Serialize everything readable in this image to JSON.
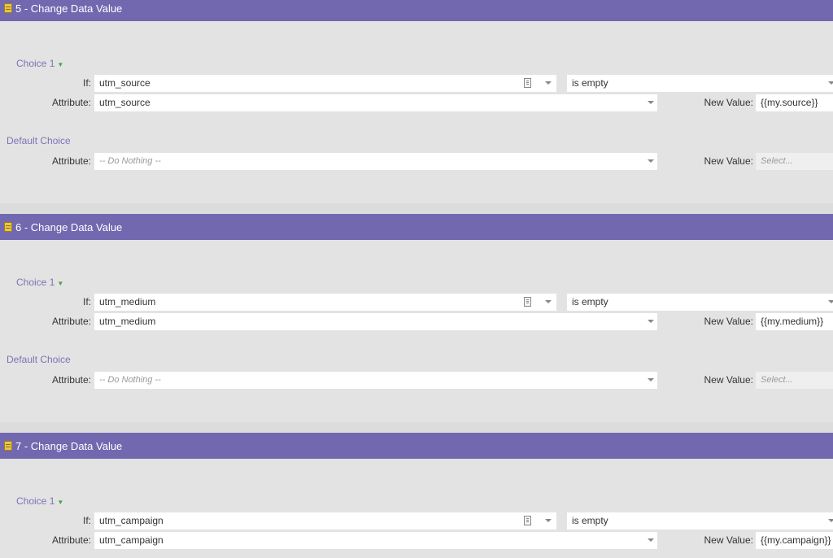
{
  "steps": [
    {
      "title": "5 - Change Data Value",
      "choice_label": "Choice 1",
      "if_label": "If:",
      "if_value": "utm_source",
      "operator": "is empty",
      "attribute_label": "Attribute:",
      "attribute_value": "utm_source",
      "new_value_label": "New Value:",
      "new_value": "{{my.source}}",
      "default_label": "Default Choice",
      "default_attribute_label": "Attribute:",
      "default_attribute_value": "-- Do Nothing --",
      "default_new_value_label": "New Value:",
      "default_new_value_placeholder": "Select..."
    },
    {
      "title": "6 - Change Data Value",
      "choice_label": "Choice 1",
      "if_label": "If:",
      "if_value": "utm_medium",
      "operator": "is empty",
      "attribute_label": "Attribute:",
      "attribute_value": "utm_medium",
      "new_value_label": "New Value:",
      "new_value": "{{my.medium}}",
      "default_label": "Default Choice",
      "default_attribute_label": "Attribute:",
      "default_attribute_value": "-- Do Nothing --",
      "default_new_value_label": "New Value:",
      "default_new_value_placeholder": "Select..."
    },
    {
      "title": "7 - Change Data Value",
      "choice_label": "Choice 1",
      "if_label": "If:",
      "if_value": "utm_campaign",
      "operator": "is empty",
      "attribute_label": "Attribute:",
      "attribute_value": "utm_campaign",
      "new_value_label": "New Value:",
      "new_value": "{{my.campaign}}"
    }
  ],
  "colors": {
    "header": "#7268b0",
    "choice_text": "#7a74b8",
    "choice_arrow": "#4aa14a"
  },
  "icons": {
    "step": "flow-step-icon",
    "token": "token-picker-icon",
    "dropdown": "chevron-down-icon",
    "choice_toggle": "triangle-down-icon"
  }
}
